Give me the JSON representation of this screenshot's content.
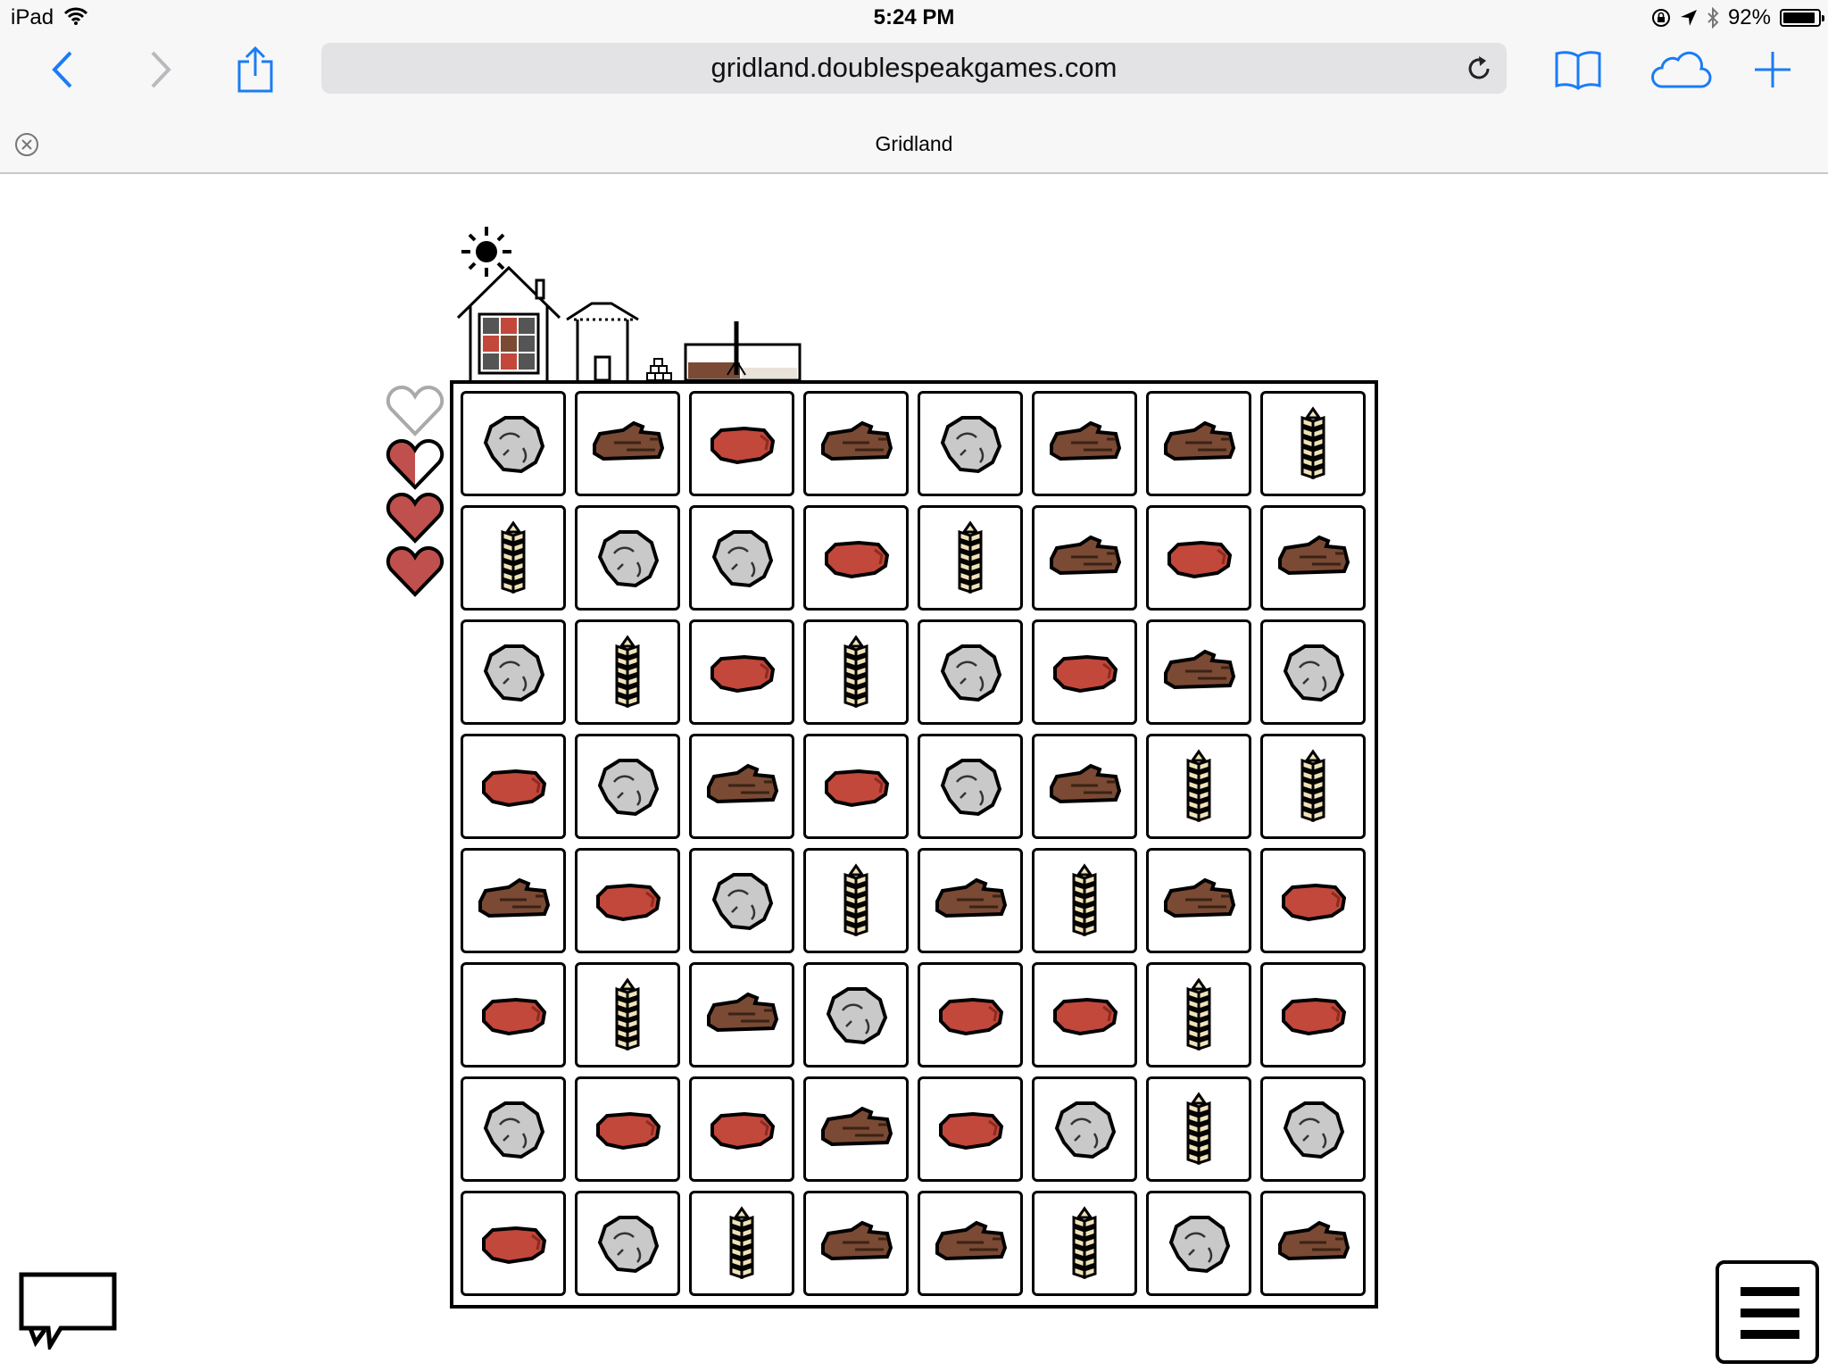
{
  "status_bar": {
    "device": "iPad",
    "time": "5:24 PM",
    "battery_text": "92%",
    "battery_level": 0.92,
    "icons": [
      "wifi-icon",
      "orientation-lock-icon",
      "location-arrow-icon",
      "bluetooth-icon",
      "battery-icon"
    ]
  },
  "browser": {
    "url": "gridland.doublespeakgames.com",
    "tab_title": "Gridland",
    "toolbar_icons": [
      "back-icon",
      "forward-icon",
      "share-icon",
      "reload-icon",
      "bookmarks-icon",
      "cloud-tabs-icon",
      "new-tab-icon",
      "close-tab-icon"
    ]
  },
  "game": {
    "hearts": [
      "empty",
      "half",
      "full",
      "full"
    ],
    "scene_icons": [
      "sun-icon",
      "house-icon",
      "storehouse-icon",
      "stone-pile-icon",
      "forge-icon"
    ],
    "board": [
      [
        "rock",
        "wood",
        "meat",
        "wood",
        "rock",
        "wood",
        "wood",
        "grain"
      ],
      [
        "grain",
        "rock",
        "rock",
        "meat",
        "grain",
        "wood",
        "meat",
        "wood"
      ],
      [
        "rock",
        "grain",
        "meat",
        "grain",
        "rock",
        "meat",
        "wood",
        "rock"
      ],
      [
        "meat",
        "rock",
        "wood",
        "meat",
        "rock",
        "wood",
        "grain",
        "grain"
      ],
      [
        "wood",
        "meat",
        "rock",
        "grain",
        "wood",
        "grain",
        "wood",
        "meat"
      ],
      [
        "meat",
        "grain",
        "wood",
        "rock",
        "meat",
        "meat",
        "grain",
        "meat"
      ],
      [
        "rock",
        "meat",
        "meat",
        "wood",
        "meat",
        "rock",
        "grain",
        "rock"
      ],
      [
        "meat",
        "rock",
        "grain",
        "wood",
        "wood",
        "grain",
        "rock",
        "wood"
      ]
    ],
    "controls": [
      "chat-icon",
      "menu-icon"
    ]
  },
  "colors": {
    "meat": "#c1483b",
    "wood": "#7a4a34",
    "rock": "#c9c9c9",
    "grain": "#f0e2b8",
    "heart": "#c0504d",
    "accent": "#1a7cf6"
  }
}
